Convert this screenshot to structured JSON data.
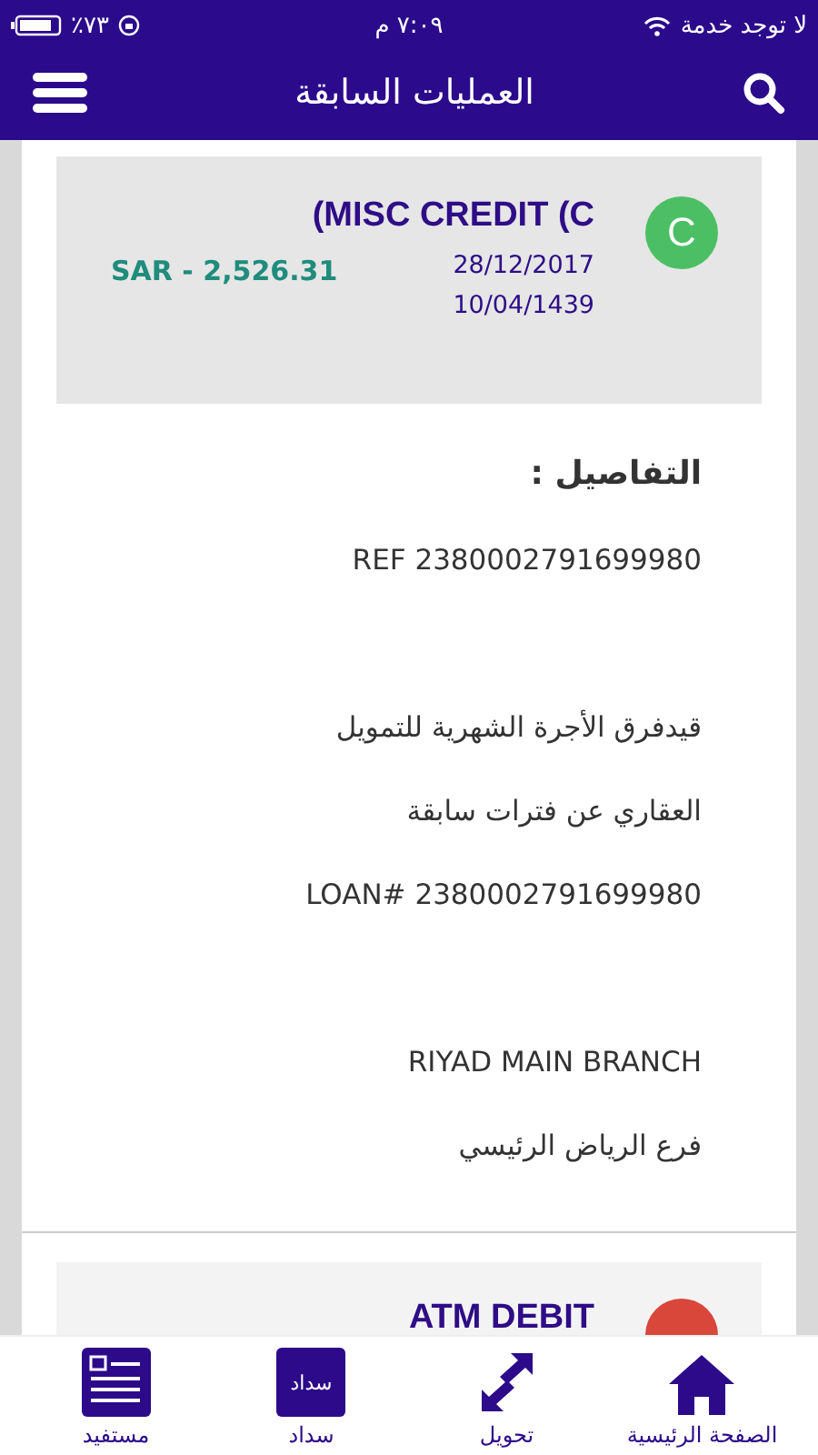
{
  "status_bar": {
    "carrier": "لا توجد خدمة",
    "time": "٧:٠٩ م",
    "battery": "٪٧٣"
  },
  "header": {
    "title": "العمليات السابقة"
  },
  "transactions": [
    {
      "letter": "C",
      "color": "#4cbf64",
      "title": "(MISC CREDIT (C",
      "amount": "SAR - 2,526.31",
      "dates": [
        "28/12/2017",
        "10/04/1439"
      ]
    },
    {
      "color": "#d9463a",
      "title": "ATM DEBIT"
    }
  ],
  "details": {
    "heading": "التفاصيل :",
    "blocks": [
      [
        "REF 2380002791699980"
      ],
      [
        "قيدفرق الأجرة الشهرية للتمويل",
        "العقاري عن فترات سابقة",
        "LOAN# 2380002791699980"
      ],
      [
        "RIYAD MAIN BRANCH",
        "فرع الرياض الرئيسي"
      ]
    ]
  },
  "tab_bar": [
    {
      "kind": "home",
      "label": "الصفحة الرئيسية"
    },
    {
      "kind": "transfer",
      "label": "تحويل"
    },
    {
      "kind": "sadad",
      "label": "سداد",
      "icon_text": "سداد"
    },
    {
      "kind": "beneficiary",
      "label": "مستفيد"
    }
  ]
}
